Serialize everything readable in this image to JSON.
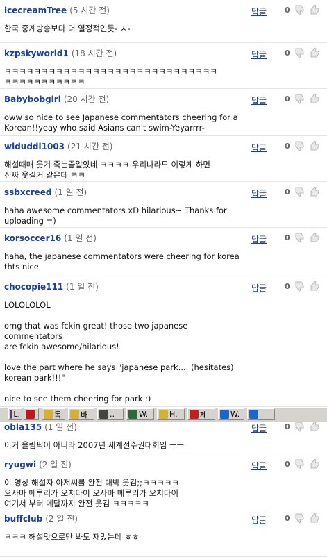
{
  "reply_label": "답글",
  "comments": [
    {
      "user": "icecreamTree",
      "time": "(5 시간 전)",
      "text": "한국 중계방송보다 더 열정적인듯- ㅅ-",
      "count": "0"
    },
    {
      "user": "kzpskyworld1",
      "time": "(18 시간 전)",
      "text": "ㅋㅋㅋㅋㅋㅋㅋㅋㅋㅋㅋㅋㅋㅋㅋㅋㅋㅋㅋㅋㅋㅋㅋㅋㅋㅋㅋㅋㅋ\nㅋㅋㅋㅋㅋㅋㅋㅋㅋㅋㅋ",
      "count": "0"
    },
    {
      "user": "Babybobgirl",
      "time": "(20 시간 전)",
      "text": "oww so nice to see Japanese commentators cheering for a\nKorean!!yeay who said Asians can't swim-Yeyarrrr-",
      "count": "0"
    },
    {
      "user": "wlduddl1003",
      "time": "(21 시간 전)",
      "text": "해설때매 웃겨 죽는줄알았네 ㅋㅋㅋㅋ 우리나라도 이렇게 하면\n진짜 웃길거 같은데 ㅋㅋ",
      "count": "0"
    },
    {
      "user": "ssbxcreed",
      "time": "(1 일 전)",
      "text": "haha awesome commentators xD hilarious~ Thanks for\nuploading =)",
      "count": "0"
    },
    {
      "user": "korsoccer16",
      "time": "(1 일 전)",
      "text": "haha, the japanese commentators were cheering for korea\nthts nice",
      "count": "0"
    },
    {
      "user": "chocopie111",
      "time": "(1 일 전)",
      "text": "LOLOLOLOL\n\nomg that was fckin great! those two japanese commentators\nare fckin awesome/hilarious!\n\nlove the part where he says \"japanese park.... (hesitates)\nkorean park!!!\"\n\nnice to see them cheering for park :)",
      "count": "0"
    },
    {
      "user": "obla135",
      "time": "(1 일 전)",
      "text": "이거 올림픽이 아니라 2007년 세계선수권대회임 ㅡㅡ",
      "count": "0"
    },
    {
      "user": "ryugwi",
      "time": "(2 일 전)",
      "text": "이 영상 해설자 아저씨를 완전 대박 웃김;;ㅋㅋㅋㅋㅋ\n오사마 메루리가 오치다이 오사마 메루리가 오치다이\n여기서 부터 메달까지 완전 웃김 ㅋㅋㅋㅋㅋ",
      "count": "0"
    },
    {
      "user": "buffclub",
      "time": "(2 일 전)",
      "text": "ㅋㅋㅋ 해설맛으로만 봐도 재밌는데 ㅎㅎ",
      "count": "0"
    }
  ],
  "taskbar": [
    {
      "label": "L.",
      "icon": "media-icon",
      "color": "#7a2a8a"
    },
    {
      "label": "",
      "icon": "pdf-icon",
      "color": "#c01818"
    },
    {
      "label": "독",
      "icon": "folder-icon",
      "color": "#d8b030"
    },
    {
      "label": "바",
      "icon": "folder-icon",
      "color": "#d8b030"
    },
    {
      "label": "..",
      "icon": "disc-icon",
      "color": "#444444"
    },
    {
      "label": "W.",
      "icon": "window-icon",
      "color": "#2a6a3a"
    },
    {
      "label": "H.",
      "icon": "folder-icon",
      "color": "#d8b030"
    },
    {
      "label": "제",
      "icon": "app-icon",
      "color": "#c02020"
    },
    {
      "label": "W.",
      "icon": "ie-icon",
      "color": "#1a66cc"
    },
    {
      "label": "",
      "icon": "ie-icon",
      "color": "#1a66cc"
    }
  ]
}
